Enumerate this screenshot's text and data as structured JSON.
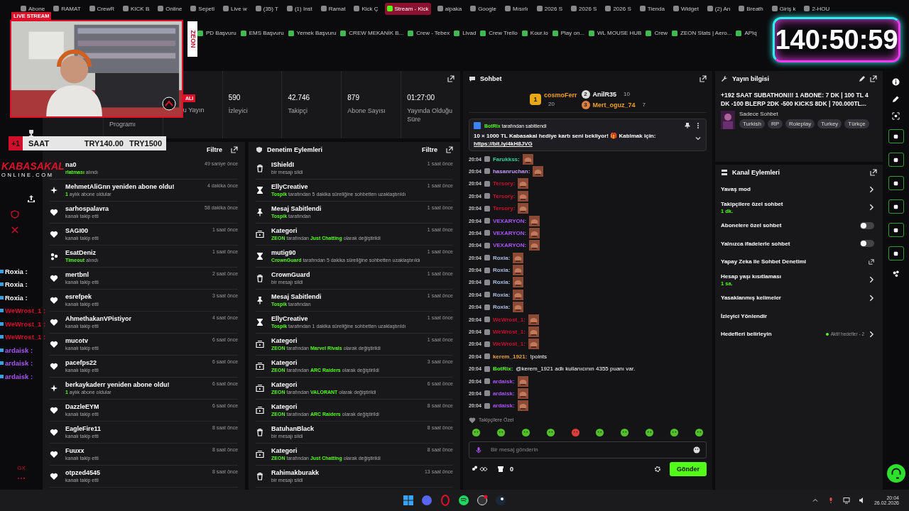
{
  "browser": {
    "tabs": [
      {
        "label": "Abone",
        "selected": false
      },
      {
        "label": "RAMAT",
        "selected": false
      },
      {
        "label": "CrewR",
        "selected": false
      },
      {
        "label": "KICK B",
        "selected": false
      },
      {
        "label": "Online",
        "selected": false
      },
      {
        "label": "Sepeti",
        "selected": false
      },
      {
        "label": "Live w",
        "selected": false
      },
      {
        "label": "(35) T",
        "selected": false
      },
      {
        "label": "(1) Inst",
        "selected": false
      },
      {
        "label": "Ramat",
        "selected": false
      },
      {
        "label": "Kick Ç",
        "selected": false
      },
      {
        "label": "Stream - Kick",
        "selected": true
      },
      {
        "label": "alpaka",
        "selected": false
      },
      {
        "label": "Google",
        "selected": false
      },
      {
        "label": "Mısırlı",
        "selected": false
      },
      {
        "label": "2026 S",
        "selected": false
      },
      {
        "label": "2026 S",
        "selected": false
      },
      {
        "label": "2026 S",
        "selected": false
      },
      {
        "label": "Tienda",
        "selected": false
      },
      {
        "label": "Widget",
        "selected": false
      },
      {
        "label": "(2) An",
        "selected": false
      },
      {
        "label": "Breath",
        "selected": false
      },
      {
        "label": "Giriş k",
        "selected": false
      },
      {
        "label": "2-HOU",
        "selected": false
      }
    ],
    "bookmarks": [
      "PD Başvuru",
      "EMS Başvuru",
      "Yemek Başvuru",
      "CREW MEKANİK B...",
      "Crew - Tebex",
      "Livad",
      "Crew Trello",
      "Kour.io",
      "Play on...",
      "WL MOUSE HUB",
      "Crew",
      "ZEON Stats | Aero...",
      "APIq"
    ]
  },
  "webcam": {
    "badge": "LIVE STREAM",
    "brand": "ZEON"
  },
  "timer": {
    "value": "140:50:59"
  },
  "subathon_bar": {
    "bonus": "+1",
    "unit": "SAAT",
    "price": "TRY140.00",
    "goal": "TRY1500"
  },
  "logo": {
    "name": "KABASAKAL",
    "domain": "ONLINE.COM"
  },
  "overlay_chat": [
    {
      "name": "Roxia :",
      "color": "#ffffff"
    },
    {
      "name": "Roxia :",
      "color": "#ffffff"
    },
    {
      "name": "Roxia :",
      "color": "#ffffff"
    },
    {
      "name": "WeWrost_1 :",
      "color": "#d0102a"
    },
    {
      "name": "WeWrost_1 :",
      "color": "#d0102a"
    },
    {
      "name": "WeWrost_1 :",
      "color": "#d0102a"
    },
    {
      "name": "ardaisk :",
      "color": "#a855f7"
    },
    {
      "name": "ardaisk :",
      "color": "#a855f7"
    },
    {
      "name": "ardaisk :",
      "color": "#a855f7"
    }
  ],
  "left_rail": {
    "footer": "GX"
  },
  "stats": {
    "badge": "ALI",
    "items": [
      {
        "label": "Programı"
      },
      {
        "label": "u Yayın"
      },
      {
        "value": "590",
        "label": "İzleyici"
      },
      {
        "value": "42.746",
        "label": "Takipçi"
      },
      {
        "value": "879",
        "label": "Abone Sayısı"
      },
      {
        "value": "01:27:00",
        "label": "Yayında Olduğu Süre"
      }
    ]
  },
  "activity": {
    "action": "Filtre",
    "rows": [
      {
        "name": "na0",
        "detail": [
          {
            "text": "rlatması",
            "highlight": true
          },
          {
            "text": " alındı",
            "highlight": false
          }
        ],
        "time": "49 saniye önce"
      },
      {
        "kind": "resub",
        "name": "MehmetAliGnn yeniden abone oldu!",
        "detail": [
          {
            "text": "1",
            "highlight": true
          },
          {
            "text": " aylık abone oldular",
            "highlight": false
          }
        ],
        "time": "4 dakika önce"
      },
      {
        "kind": "follow",
        "name": "sarhospalavra",
        "detail": [
          {
            "text": "kanalı takip etti",
            "highlight": false
          }
        ],
        "time": "58 dakika önce"
      },
      {
        "kind": "follow",
        "name": "SAGI00",
        "detail": [
          {
            "text": "kanalı takip etti",
            "highlight": false
          }
        ],
        "time": "1 saat önce"
      },
      {
        "kind": "timeout",
        "name": "EsatDeniz",
        "detail": [
          {
            "text": "Timeout",
            "highlight": true
          },
          {
            "text": " alındı",
            "highlight": false
          }
        ],
        "time": "1 saat önce"
      },
      {
        "kind": "follow",
        "name": "mertbnl",
        "detail": [
          {
            "text": "kanalı takip etti",
            "highlight": false
          }
        ],
        "time": "2 saat önce"
      },
      {
        "kind": "follow",
        "name": "esrefpek",
        "detail": [
          {
            "text": "kanalı takip etti",
            "highlight": false
          }
        ],
        "time": "3 saat önce"
      },
      {
        "kind": "follow",
        "name": "AhmethakanVPistiyor",
        "detail": [
          {
            "text": "kanalı takip etti",
            "highlight": false
          }
        ],
        "time": "4 saat önce"
      },
      {
        "kind": "follow",
        "name": "mucotv",
        "detail": [
          {
            "text": "kanalı takip etti",
            "highlight": false
          }
        ],
        "time": "6 saat önce"
      },
      {
        "kind": "follow",
        "name": "pacefps22",
        "detail": [
          {
            "text": "kanalı takip etti",
            "highlight": false
          }
        ],
        "time": "6 saat önce"
      },
      {
        "kind": "resub",
        "name": "berkaykaderr yeniden abone oldu!",
        "detail": [
          {
            "text": "1",
            "highlight": true
          },
          {
            "text": " aylık abone oldular",
            "highlight": false
          }
        ],
        "time": "6 saat önce"
      },
      {
        "kind": "follow",
        "name": "DazzleEYM",
        "detail": [
          {
            "text": "kanalı takip etti",
            "highlight": false
          }
        ],
        "time": "6 saat önce"
      },
      {
        "kind": "follow",
        "name": "EagleFire11",
        "detail": [
          {
            "text": "kanalı takip etti",
            "highlight": false
          }
        ],
        "time": "8 saat önce"
      },
      {
        "kind": "follow",
        "name": "Fuuxx",
        "detail": [
          {
            "text": "kanalı takip etti",
            "highlight": false
          }
        ],
        "time": "8 saat önce"
      },
      {
        "kind": "follow",
        "name": "otpzed4545",
        "detail": [
          {
            "text": "kanalı takip etti",
            "highlight": false
          }
        ],
        "time": "8 saat önce"
      }
    ]
  },
  "moderation": {
    "title": "Denetim Eylemleri",
    "action": "Filtre",
    "rows": [
      {
        "kind": "delete",
        "name": "IShieldI",
        "detail": [
          {
            "text": "bir mesajı sildi",
            "highlight": false
          }
        ],
        "time": "1 saat önce"
      },
      {
        "kind": "timeout",
        "name": "EllyCreative",
        "detail": [
          {
            "text": "Tospik",
            "highlight": true
          },
          {
            "text": " tarafından 5 dakika süreliğine sohbetten uzaklaştırıldı",
            "highlight": false
          }
        ],
        "time": "1 saat önce"
      },
      {
        "kind": "pin",
        "name": "Mesaj Sabitlendi",
        "detail": [
          {
            "text": "Tospik",
            "highlight": true
          },
          {
            "text": " tarafından",
            "highlight": false
          }
        ],
        "time": "1 saat önce"
      },
      {
        "kind": "category",
        "name": "Kategori",
        "detail": [
          {
            "text": "ZEON",
            "highlight": true
          },
          {
            "text": " tarafından ",
            "highlight": false
          },
          {
            "text": "Just Chatting",
            "highlight": true
          },
          {
            "text": " olarak değiştirildi",
            "highlight": false
          }
        ],
        "time": "1 saat önce"
      },
      {
        "kind": "timeout",
        "name": "mutig90",
        "detail": [
          {
            "text": "CrownGuard",
            "highlight": true
          },
          {
            "text": " tarafından 5 dakika süreliğine sohbetten uzaklaştırıldı",
            "highlight": false
          }
        ],
        "time": "1 saat önce"
      },
      {
        "kind": "delete",
        "name": "CrownGuard",
        "detail": [
          {
            "text": "bir mesajı sildi",
            "highlight": false
          }
        ],
        "time": "1 saat önce"
      },
      {
        "kind": "pin",
        "name": "Mesaj Sabitlendi",
        "detail": [
          {
            "text": "Tospik",
            "highlight": true
          },
          {
            "text": " tarafından",
            "highlight": false
          }
        ],
        "time": "1 saat önce"
      },
      {
        "kind": "timeout",
        "name": "EllyCreative",
        "detail": [
          {
            "text": "Tospik",
            "highlight": true
          },
          {
            "text": " tarafından 1 dakika süreliğine sohbetten uzaklaştırıldı",
            "highlight": false
          }
        ],
        "time": "1 saat önce"
      },
      {
        "kind": "category",
        "name": "Kategori",
        "detail": [
          {
            "text": "ZEON",
            "highlight": true
          },
          {
            "text": " tarafından ",
            "highlight": false
          },
          {
            "text": "Marvel Rivals",
            "highlight": true
          },
          {
            "text": " olarak değiştirildi",
            "highlight": false
          }
        ],
        "time": "1 saat önce"
      },
      {
        "kind": "category",
        "name": "Kategori",
        "detail": [
          {
            "text": "ZEON",
            "highlight": true
          },
          {
            "text": " tarafından ",
            "highlight": false
          },
          {
            "text": "ARC Raiders",
            "highlight": true
          },
          {
            "text": " olarak değiştirildi",
            "highlight": false
          }
        ],
        "time": "3 saat önce"
      },
      {
        "kind": "category",
        "name": "Kategori",
        "detail": [
          {
            "text": "ZEON",
            "highlight": true
          },
          {
            "text": " tarafından ",
            "highlight": false
          },
          {
            "text": "VALORANT",
            "highlight": true
          },
          {
            "text": " olarak değiştirildi",
            "highlight": false
          }
        ],
        "time": "6 saat önce"
      },
      {
        "kind": "category",
        "name": "Kategori",
        "detail": [
          {
            "text": "ZEON",
            "highlight": true
          },
          {
            "text": " tarafından ",
            "highlight": false
          },
          {
            "text": "ARC Raiders",
            "highlight": true
          },
          {
            "text": " olarak değiştirildi",
            "highlight": false
          }
        ],
        "time": "8 saat önce"
      },
      {
        "kind": "delete",
        "name": "BatuhanBlack",
        "detail": [
          {
            "text": "bir mesajı sildi",
            "highlight": false
          }
        ],
        "time": "8 saat önce"
      },
      {
        "kind": "category",
        "name": "Kategori",
        "detail": [
          {
            "text": "ZEON",
            "highlight": true
          },
          {
            "text": " tarafından ",
            "highlight": false
          },
          {
            "text": "Just Chatting",
            "highlight": true
          },
          {
            "text": " olarak değiştirildi",
            "highlight": false
          }
        ],
        "time": "8 saat önce"
      },
      {
        "kind": "delete",
        "name": "Rahimakburakk",
        "detail": [
          {
            "text": "bir mesajı sildi",
            "highlight": false
          }
        ],
        "time": "13 saat önce"
      }
    ]
  },
  "chat": {
    "title": "Sohbet",
    "gifters": [
      {
        "rank": "1",
        "name": "cosmoFerr",
        "count": "20"
      },
      {
        "rank": "2",
        "name": "AnilR35",
        "count": "10"
      },
      {
        "rank": "3",
        "name": "Mert_oguz_74",
        "count": "7"
      }
    ],
    "pinned": {
      "by": "BotRix",
      "note": "tarafından sabitlendi",
      "message": "10 × 1000 TL Kabasakal hediye kartı seni bekliyor! 🎁 Katılmak için:",
      "link": "https://bit.ly/4kH8JVG"
    },
    "messages": [
      {
        "time": "20:04",
        "user": "Farukkss:",
        "color": "#2dd4a0",
        "kind": "emote"
      },
      {
        "time": "20:04",
        "user": "hasanruchan:",
        "color": "#c39bf5",
        "kind": "emote"
      },
      {
        "time": "20:04",
        "user": "Tersory:",
        "color": "#c8102e",
        "kind": "emote"
      },
      {
        "time": "20:04",
        "user": "Tersory:",
        "color": "#c8102e",
        "kind": "emote"
      },
      {
        "time": "20:04",
        "user": "Tersory:",
        "color": "#c8102e",
        "kind": "emote"
      },
      {
        "time": "20:04",
        "user": "VEXARYON:",
        "color": "#a855f7",
        "kind": "emote"
      },
      {
        "time": "20:04",
        "user": "VEXARYON:",
        "color": "#a855f7",
        "kind": "emote"
      },
      {
        "time": "20:04",
        "user": "VEXARYON:",
        "color": "#a855f7",
        "kind": "emote"
      },
      {
        "time": "20:04",
        "user": "Roxia:",
        "color": "#a9bde0",
        "kind": "emote"
      },
      {
        "time": "20:04",
        "user": "Roxia:",
        "color": "#a9bde0",
        "kind": "emote"
      },
      {
        "time": "20:04",
        "user": "Roxia:",
        "color": "#a9bde0",
        "kind": "emote"
      },
      {
        "time": "20:04",
        "user": "Roxia:",
        "color": "#a9bde0",
        "kind": "emote"
      },
      {
        "time": "20:04",
        "user": "Roxia:",
        "color": "#a9bde0",
        "kind": "emote"
      },
      {
        "time": "20:04",
        "user": "WeWrost_1:",
        "color": "#c8102e",
        "kind": "emote"
      },
      {
        "time": "20:04",
        "user": "WeWrost_1:",
        "color": "#c8102e",
        "kind": "emote"
      },
      {
        "time": "20:04",
        "user": "WeWrost_1:",
        "color": "#c8102e",
        "kind": "emote"
      },
      {
        "time": "20:04",
        "user": "kerem_1921:",
        "color": "#e8a33a",
        "kind": "text",
        "text": "!points"
      },
      {
        "time": "20:04",
        "user": "BotRix:",
        "color": "#53fc18",
        "kind": "text",
        "text": "@kerem_1921 adlı kullanıcının 4355 puanı var."
      },
      {
        "time": "20:04",
        "user": "ardaisk:",
        "color": "#a855f7",
        "kind": "emote"
      },
      {
        "time": "20:04",
        "user": "ardaisk:",
        "color": "#a855f7",
        "kind": "emote"
      },
      {
        "time": "20:04",
        "user": "ardaisk:",
        "color": "#a855f7",
        "kind": "emote"
      }
    ],
    "emote_label": "Takipçilere Özel",
    "input": {
      "placeholder": "Bir mesaj gönderin"
    },
    "points": "0",
    "send": "Gönder"
  },
  "stream_info": {
    "title": "Yayın bilgisi",
    "stream_title": "+192 SAAT SUBATHON!!! 1 ABONE: 7 DK | 100 TL 4 DK -100 BLERP 2DK -500 KICKS 8DK | 700.000TL...",
    "category": "Sadece Sohbet",
    "tags": [
      "Turkish",
      "RP",
      "Roleplay",
      "Turkey",
      "Türkçe"
    ]
  },
  "channel_actions": {
    "title": "Kanal Eylemleri",
    "items": [
      {
        "kind": "arrow",
        "label": "Yavaş mod"
      },
      {
        "kind": "arrow",
        "label": "Takipçilere özel sohbet",
        "detail": "1 dk."
      },
      {
        "kind": "toggle",
        "label": "Abonelere özel sohbet",
        "on": false
      },
      {
        "kind": "toggle",
        "label": "Yalnızca ifadelerle sohbet",
        "on": false
      },
      {
        "kind": "external",
        "label": "Yapay Zeka ile Sohbet Denetimi"
      },
      {
        "kind": "arrow",
        "label": "Hesap yaşı kısıtlaması",
        "detail": "1 sa."
      },
      {
        "kind": "arrow",
        "label": "Yasaklanmış kelimeler"
      },
      {
        "kind": "plain",
        "label": "İzleyici Yönlendir"
      },
      {
        "kind": "goal",
        "label": "Hedefleri belirleyin",
        "status": "Aktif hedefler - 2"
      }
    ]
  },
  "taskbar": {
    "time": "20:04",
    "date": "26.02.2026"
  }
}
